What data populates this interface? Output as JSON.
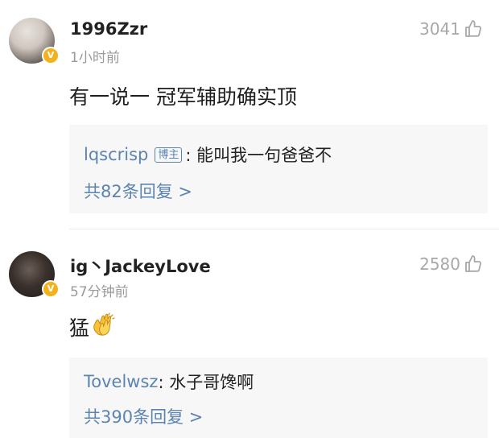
{
  "comments": [
    {
      "username": "1996Zzr",
      "timestamp": "1小时前",
      "likes": "3041",
      "verified_badge": "V",
      "content": "有一说一 冠军辅助确实顶",
      "reply": {
        "user": "lqscrisp",
        "badge": "博主",
        "text": ": 能叫我一句爸爸不",
        "count_text": "共82条回复 >"
      }
    },
    {
      "username": "ig丶JackeyLove",
      "timestamp": "57分钟前",
      "likes": "2580",
      "verified_badge": "V",
      "content": "猛",
      "content_emoji": "clapping-hands-icon",
      "reply": {
        "user": "Tovelwsz",
        "text": ": 水子哥馋啊",
        "count_text": "共390条回复 >"
      }
    }
  ],
  "colors": {
    "link": "#5b84b1",
    "muted": "#9a9a9a",
    "reply_bg": "#f7f7f7",
    "verified": "#f3b21c"
  }
}
